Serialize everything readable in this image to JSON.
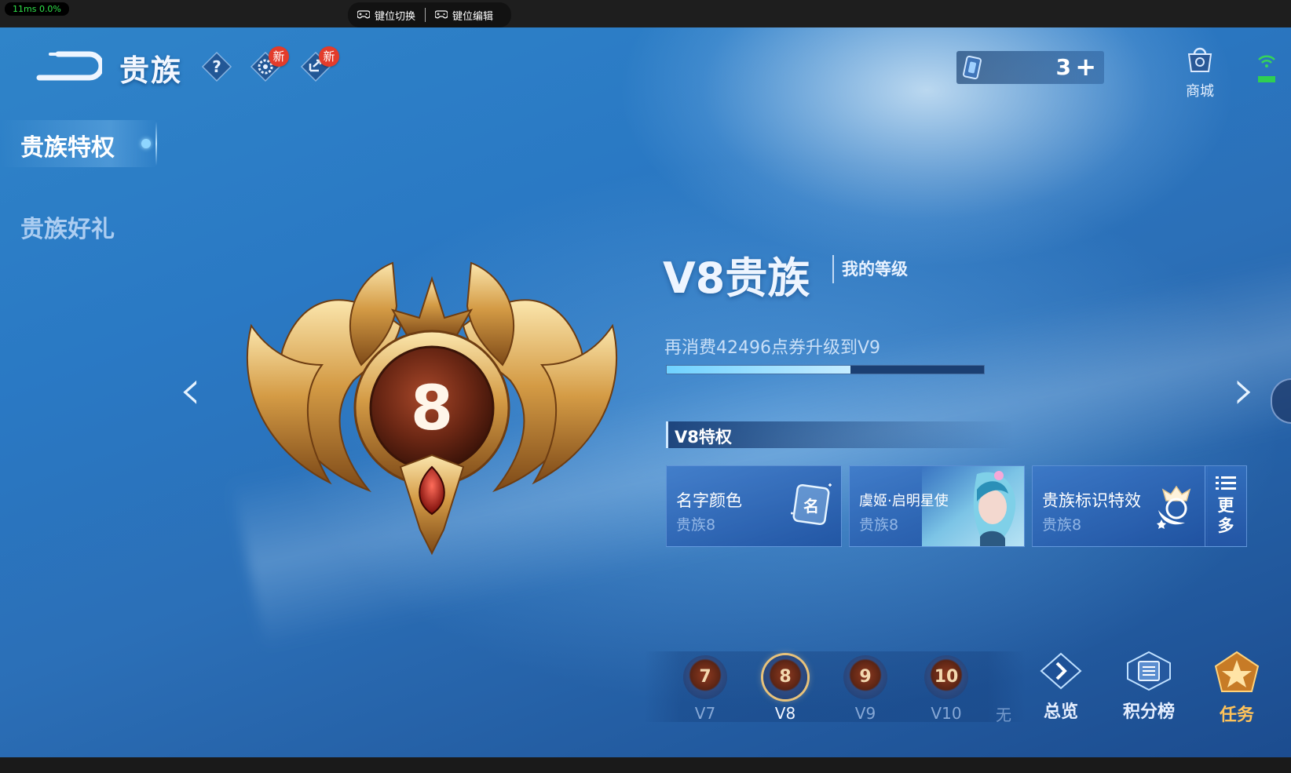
{
  "system": {
    "perf": "11ms 0.0%",
    "key_switch_label": "键位切换",
    "key_edit_label": "键位编辑"
  },
  "header": {
    "title": "贵族",
    "badge_settings": "新",
    "badge_share": "新",
    "currency_value": "3",
    "shop_label": "商城"
  },
  "sidebar": {
    "items": [
      {
        "label": "贵族特权",
        "active": true
      },
      {
        "label": "贵族好礼",
        "active": false
      }
    ]
  },
  "main": {
    "emblem_level": "8",
    "rank_title": "V8贵族",
    "my_level_label": "我的等级",
    "upgrade_text": "再消费42496点券升级到V9",
    "progress": 0.58,
    "privilege_header": "V8特权",
    "privileges": [
      {
        "name": "名字颜色",
        "sub": "贵族8",
        "icon": "name-card-icon"
      },
      {
        "name": "虞姬·启明星使",
        "sub": "贵族8",
        "icon": "hero-skin-portrait"
      },
      {
        "name": "贵族标识特效",
        "sub": "贵族8",
        "icon": "noble-mark-icon"
      }
    ],
    "more_label_1": "更",
    "more_label_2": "多"
  },
  "levels": [
    {
      "num": "7",
      "label": "V7",
      "selected": false
    },
    {
      "num": "8",
      "label": "V8",
      "selected": true
    },
    {
      "num": "9",
      "label": "V9",
      "selected": false
    },
    {
      "num": "10",
      "label": "V10",
      "selected": false
    }
  ],
  "levels_partial_label": "无",
  "bottom_nav": {
    "overview_label": "总览",
    "ranking_label": "积分榜",
    "task_label": "任务"
  },
  "colors": {
    "accent_gold": "#e8c27a",
    "badge_red": "#e33c2b",
    "progress": "#6fd2ff",
    "task_orange": "#ffc35a"
  }
}
